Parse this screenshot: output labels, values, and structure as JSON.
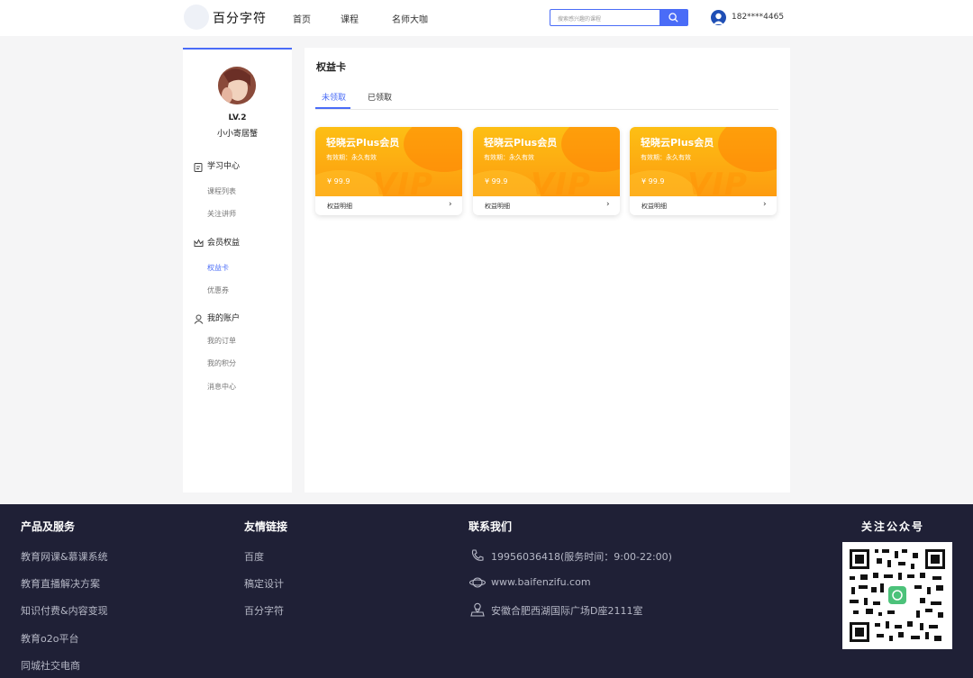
{
  "header": {
    "brand": "百分字符",
    "nav": [
      "首页",
      "课程",
      "名师大咖"
    ],
    "search_placeholder": "搜索感兴趣的课程",
    "user_phone": "182****4465"
  },
  "sidebar": {
    "level": "LV.2",
    "username": "小小寄居蟹",
    "sections": [
      {
        "title": "学习中心",
        "icon": "clipboard-icon",
        "items": [
          "课程列表",
          "关注讲师"
        ]
      },
      {
        "title": "会员权益",
        "icon": "crown-icon",
        "items": [
          "权益卡",
          "优惠券"
        ]
      },
      {
        "title": "我的账户",
        "icon": "user-icon",
        "items": [
          "我的订单",
          "我的积分",
          "消息中心"
        ]
      }
    ],
    "active_item": "权益卡"
  },
  "main": {
    "title": "权益卡",
    "tabs": [
      "未领取",
      "已领取"
    ],
    "active_tab": "未领取",
    "cards": [
      {
        "title": "轻晓云Plus会员",
        "validity": "有效期：永久有效",
        "price": "¥ 99.9",
        "detail": "权益明细",
        "watermark": "VIP"
      },
      {
        "title": "轻晓云Plus会员",
        "validity": "有效期：永久有效",
        "price": "¥ 99.9",
        "detail": "权益明细",
        "watermark": "VIP"
      },
      {
        "title": "轻晓云Plus会员",
        "validity": "有效期：永久有效",
        "price": "¥ 99.9",
        "detail": "权益明细",
        "watermark": "VIP"
      }
    ]
  },
  "footer": {
    "products": {
      "title": "产品及服务",
      "items": [
        "教育网课&慕课系统",
        "教育直播解决方案",
        "知识付费&内容变现",
        "教育o2o平台",
        "同城社交电商"
      ]
    },
    "links": {
      "title": "友情链接",
      "items": [
        "百度",
        "稿定设计",
        "百分字符"
      ]
    },
    "contact": {
      "title": "联系我们",
      "phone": "19956036418(服务时间：9:00-22:00)",
      "website": "www.baifenzifu.com",
      "address": "安徽合肥西湖国际广场D座2111室"
    },
    "qr": {
      "title": "关注公众号"
    }
  },
  "colors": {
    "accent": "#4a6cf7",
    "card_orange": "#fdab12",
    "footer_bg": "#1f2036"
  }
}
